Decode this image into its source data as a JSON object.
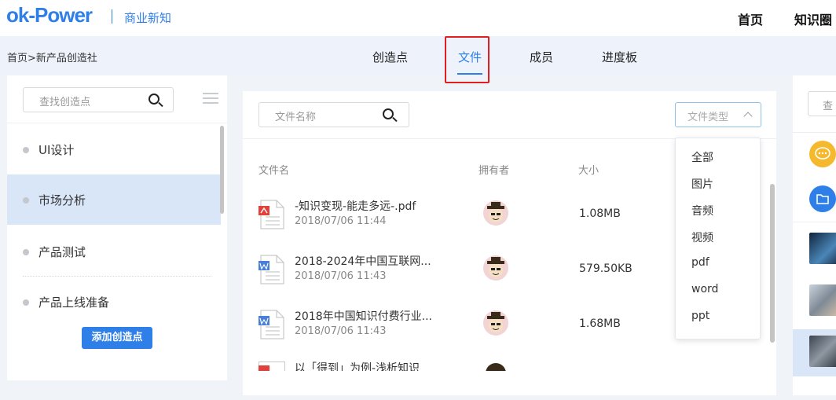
{
  "header": {
    "logo_text": "ok-Power",
    "subtitle": "商业新知",
    "nav": [
      {
        "label": "首页"
      },
      {
        "label": "知识圈"
      }
    ]
  },
  "breadcrumb": "首页>新产品创造社",
  "tabs": [
    {
      "label": "创造点",
      "active": false
    },
    {
      "label": "文件",
      "active": true
    },
    {
      "label": "成员",
      "active": false
    },
    {
      "label": "进度板",
      "active": false
    }
  ],
  "left_panel": {
    "search_placeholder": "查找创造点",
    "items": [
      {
        "label": "UI设计",
        "selected": false
      },
      {
        "label": "市场分析",
        "selected": true
      },
      {
        "label": "产品测试",
        "selected": false
      },
      {
        "label": "产品上线准备",
        "selected": false
      }
    ],
    "add_button": "添加创造点"
  },
  "files_panel": {
    "search_placeholder": "文件名称",
    "type_filter": {
      "placeholder": "文件类型",
      "options": [
        "全部",
        "图片",
        "音频",
        "视频",
        "pdf",
        "word",
        "ppt"
      ]
    },
    "columns": {
      "name": "文件名",
      "owner": "拥有者",
      "size": "大小"
    },
    "rows": [
      {
        "name": "-知识变现-能走多远-.pdf",
        "date": "2018/07/06 11:44",
        "size": "1.08MB",
        "file_type": "pdf"
      },
      {
        "name": "2018-2024年中国互联网...",
        "date": "2018/07/06 11:43",
        "size": "579.50KB",
        "file_type": "word"
      },
      {
        "name": "2018年中国知识付费行业...",
        "date": "2018/07/06 11:43",
        "size": "1.68MB",
        "file_type": "word"
      },
      {
        "name": "以「得到」为例-浅析知识",
        "date": "",
        "size": "",
        "file_type": "pdf"
      }
    ]
  },
  "right_panel": {
    "search_placeholder": "查"
  },
  "colors": {
    "accent": "#2f7fe8",
    "highlight_border": "#e02020",
    "selected_bg": "#d8e6f8",
    "pdf_icon": "#e0413a",
    "word_icon": "#4a7fd8",
    "chat_circle": "#f5b92d"
  }
}
